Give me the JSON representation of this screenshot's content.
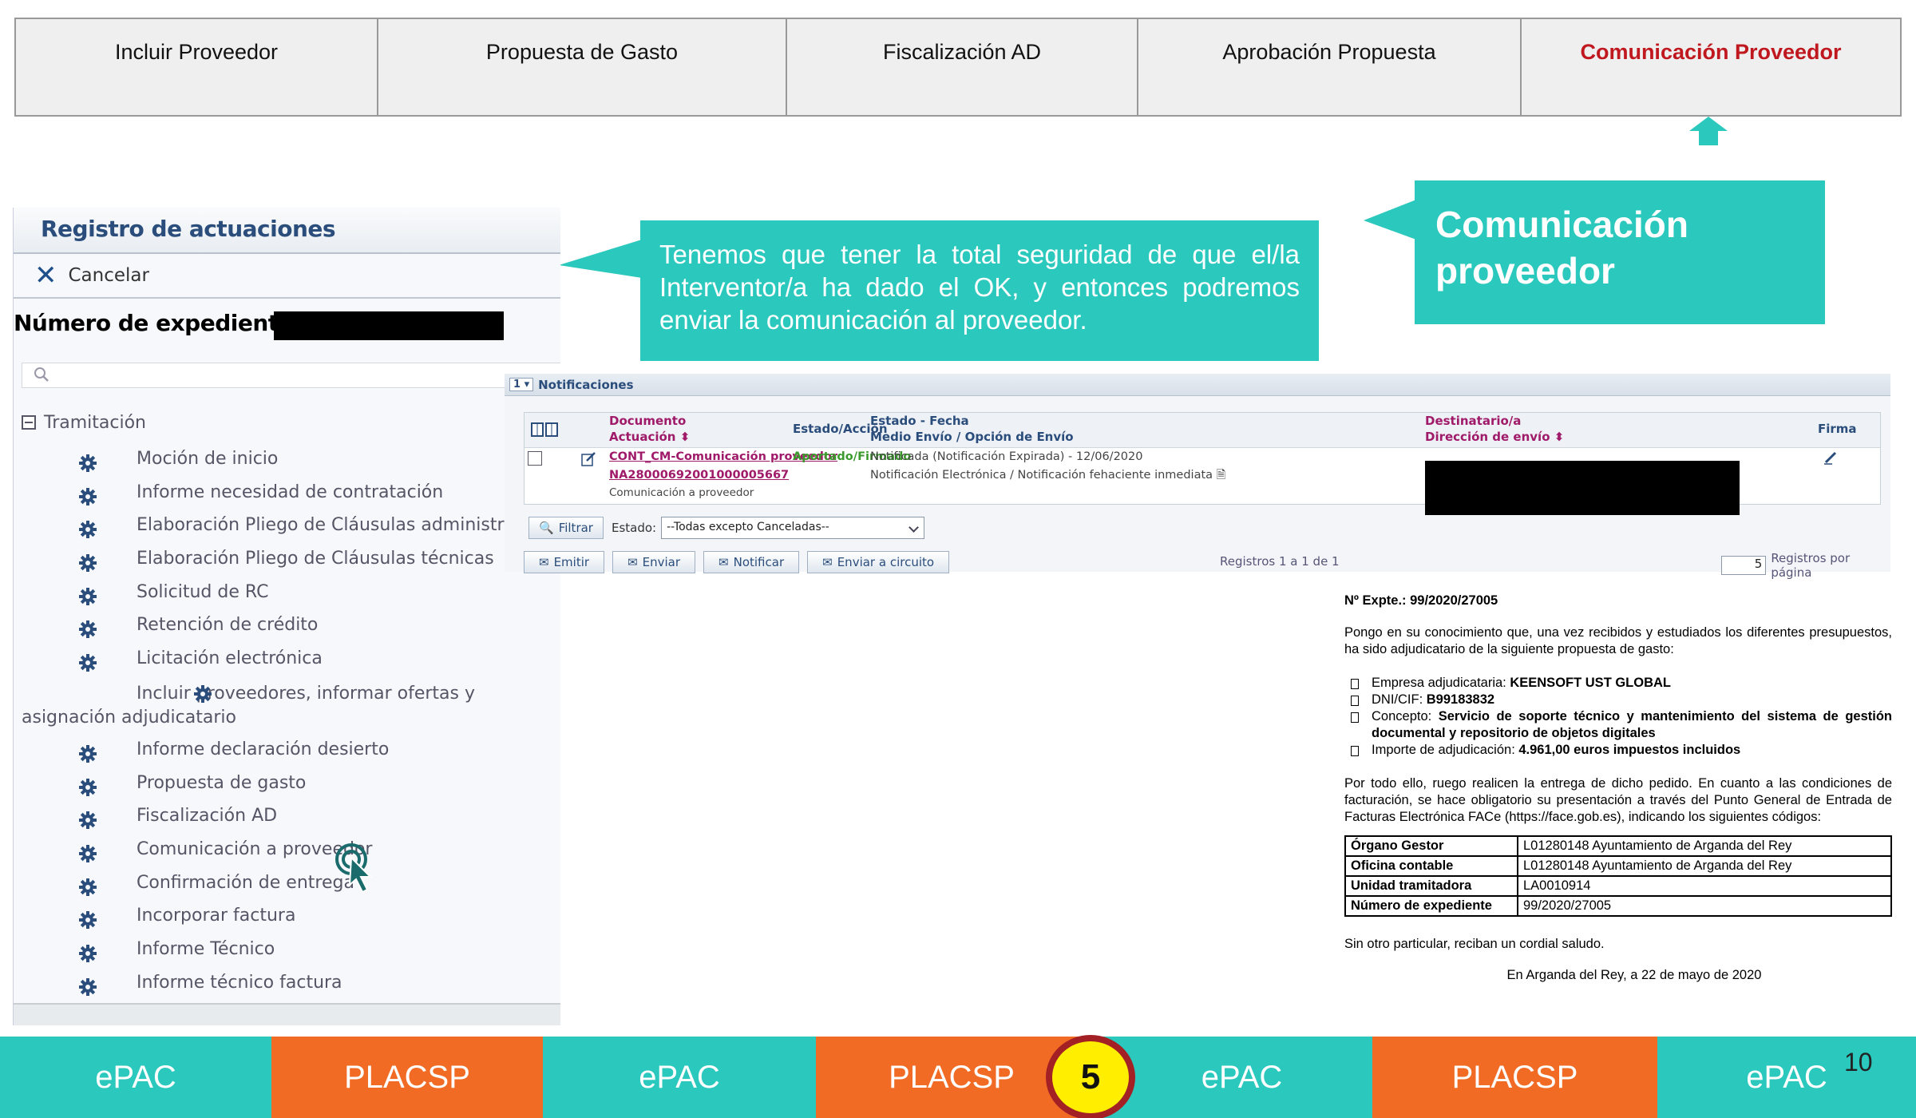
{
  "tabs": [
    {
      "label": "Incluir Proveedor",
      "active": false
    },
    {
      "label": "Propuesta de Gasto",
      "active": false
    },
    {
      "label": "Fiscalización AD",
      "active": false
    },
    {
      "label": "Aprobación Propuesta",
      "active": false
    },
    {
      "label": "Comunicación Proveedor",
      "active": true
    }
  ],
  "colors": {
    "teal": "#2bc8bd",
    "orange": "#f26b24",
    "active_tab": "#c0181f",
    "panel_title": "#2a4d7c",
    "link": "#a01a6a"
  },
  "callout_main": "Tenemos que tener la total seguridad  de que el/la Interventor/a ha dado el OK, y entonces podremos enviar la comunicación al proveedor.",
  "callout_title": "Comunicación proveedor",
  "left_panel": {
    "title": "Registro de actuaciones",
    "cancel_label": "Cancelar",
    "expediente_label": "Número de expediente :",
    "tree_root": "Tramitación",
    "items": [
      "Moción de inicio",
      "Informe necesidad de contratación",
      "Elaboración Pliego de Cláusulas administrativas",
      "Elaboración Pliego de Cláusulas técnicas",
      "Solicitud de RC",
      "Retención de crédito",
      "Licitación electrónica",
      "Incluir proveedores, informar ofertas y asignación adjudicatario",
      "Informe declaración desierto",
      "Propuesta de gasto",
      "Fiscalización AD",
      "Comunicación a proveedor",
      "Confirmación de entrega",
      "Incorporar factura",
      "Informe Técnico",
      "Informe técnico factura"
    ]
  },
  "notifications": {
    "title": "Notificaciones",
    "page_select": "1",
    "headers": {
      "documento": "Documento",
      "actuacion": "Actuación",
      "estado_accion": "Estado/Acción",
      "estado_fecha": "Estado - Fecha",
      "medio_envio": "Medio Envío / Opción de Envío",
      "destinatario": "Destinatario/a",
      "direccion": "Dirección de envío",
      "firma": "Firma"
    },
    "row": {
      "doc_link": "CONT_CM-Comunicación proveedor",
      "doc_id": "NA28000692001000005667",
      "doc_sub": "Comunicación a proveedor",
      "estado_accion": "Aportado/Firmado",
      "estado_fecha": "Notificada (Notificación Expirada) - 12/06/2020",
      "medio": "Notificación Electrónica / Notificación fehaciente inmediata"
    },
    "filter_label": "Filtrar",
    "estado_label": "Estado:",
    "estado_value": "--Todas excepto Canceladas--",
    "actions": [
      "Emitir",
      "Enviar",
      "Notificar",
      "Enviar a circuito"
    ],
    "registros": "Registros 1 a 1 de 1",
    "per_page_value": "5",
    "per_page_label": "Registros por página"
  },
  "document": {
    "expte": "Nº Expte.: 99/2020/27005",
    "intro": "Pongo en su conocimiento que, una vez recibidos y estudiados los diferentes presupuestos, ha sido adjudicatario de la siguiente propuesta de gasto:",
    "bullets": [
      {
        "label": "Empresa adjudicataria: ",
        "value": "KEENSOFT UST GLOBAL"
      },
      {
        "label": "DNI/CIF: ",
        "value": "B99183832"
      },
      {
        "label": "Concepto: ",
        "value": "Servicio de soporte técnico y mantenimiento del sistema de gestión documental y repositorio de objetos digitales"
      },
      {
        "label": "Importe de adjudicación: ",
        "value": "4.961,00 euros impuestos incluidos"
      }
    ],
    "body": "Por todo ello, ruego realicen la entrega de dicho pedido. En cuanto a las condiciones de facturación, se hace obligatorio su presentación a través del Punto General de Entrada de Facturas Electrónica FACe (https://face.gob.es), indicando los siguientes códigos:",
    "table": [
      [
        "Órgano Gestor",
        "L01280148 Ayuntamiento de Arganda del Rey"
      ],
      [
        "Oficina contable",
        "L01280148 Ayuntamiento de Arganda del Rey"
      ],
      [
        "Unidad tramitadora",
        "LA0010914"
      ],
      [
        "Número de expediente",
        "99/2020/27005"
      ]
    ],
    "closing": "Sin otro particular, reciban un cordial saludo.",
    "signature": "En Arganda del Rey, a 22 de mayo de 2020"
  },
  "footer": {
    "segments": [
      "ePAC",
      "PLACSP",
      "ePAC",
      "PLACSP",
      "ePAC",
      "PLACSP",
      "ePAC"
    ],
    "step": "5",
    "page_number": "10"
  }
}
